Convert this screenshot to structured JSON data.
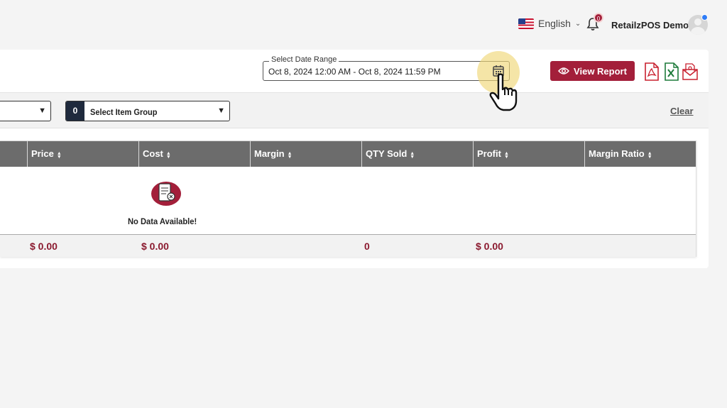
{
  "header": {
    "language": "English",
    "notification_count": "0",
    "user_name": "RetailzPOS Demo"
  },
  "report": {
    "date_range_label": "Select Date Range",
    "date_range_value": "Oct 8, 2024 12:00 AM - Oct 8, 2024 11:59 PM",
    "view_report_label": "View Report",
    "exports": [
      "pdf-export-icon",
      "excel-export-icon",
      "email-export-icon"
    ]
  },
  "filters": {
    "item_group_count": "0",
    "item_group_label": "Select Item Group",
    "clear_label": "Clear"
  },
  "table": {
    "columns": [
      "Price",
      "Cost",
      "Margin",
      "QTY Sold",
      "Profit",
      "Margin Ratio"
    ],
    "empty_message": "No Data Available!",
    "totals": {
      "price": "$ 0.00",
      "cost": "$ 0.00",
      "qty_sold": "0",
      "profit": "$ 0.00"
    }
  },
  "colors": {
    "brand": "#a31f3a",
    "header_gray": "#6c6c6c",
    "totals_text": "#8b1a2f"
  }
}
